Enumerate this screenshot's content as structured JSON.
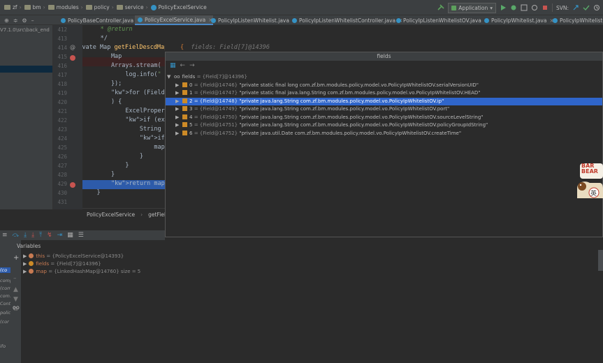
{
  "navbar": {
    "crumbs": [
      "zf",
      "bm",
      "modules",
      "policy",
      "service",
      "PolicyExcelService"
    ],
    "run_config": "Application",
    "svn_label": "SVN:"
  },
  "tabs": [
    {
      "label": "PolicyBaseController.java"
    },
    {
      "label": "PolicyExcelService.java"
    },
    {
      "label": "PolicyIpListenWhitelist.java"
    },
    {
      "label": "PolicyIpListenWhitelistController.java"
    },
    {
      "label": "PolicyIpListenWhitelistOV.java"
    },
    {
      "label": "PolicyIpWhitelist.java"
    },
    {
      "label": "PolicyIpWhitelistOV.j..."
    }
  ],
  "project": {
    "path": "V7.1.0\\src\\back_end"
  },
  "editor": {
    "line_numbers": [
      "412",
      "413",
      "414",
      "415",
      "416",
      "417",
      "418",
      "419",
      "420",
      "421",
      "422",
      "423",
      "424",
      "425",
      "426",
      "427",
      "428",
      "429",
      "430",
      "431"
    ],
    "lines": [
      "     * @return",
      "     */",
      "    private Map<String, String> getFielDescdMap(Field[] fields) {",
      "        Map<String, St",
      "        Arrays.stream(",
      "            log.info(\"",
      "        });",
      "        for (Field fie",
      "        ) {",
      "            ExcelProper",
      "            if (excelPr",
      "                String",
      "                if (de",
      "                    map",
      "                }",
      "            }",
      "        }",
      "        return map;  m",
      "    }",
      ""
    ],
    "inline_hint": "fields: Field[7]@14396",
    "footer": [
      "PolicyExcelService",
      "getFielDescd"
    ]
  },
  "popup": {
    "title": "fields",
    "root": {
      "name": "fields",
      "value": "{Field[7]@14396}"
    },
    "items": [
      {
        "index": "0",
        "ref": "{Field@14746}",
        "text": "\"private static final long com.zf.bm.modules.policy.model.vo.PolicyIpWhitelistOV.serialVersionUID\""
      },
      {
        "index": "1",
        "ref": "{Field@14747}",
        "text": "\"private static final java.lang.String com.zf.bm.modules.policy.model.vo.PolicyIpWhitelistOV.HEAD\""
      },
      {
        "index": "2",
        "ref": "{Field@14748}",
        "text": "\"private java.lang.String com.zf.bm.modules.policy.model.vo.PolicyIpWhitelistOV.ip\""
      },
      {
        "index": "3",
        "ref": "{Field@14749}",
        "text": "\"private java.lang.String com.zf.bm.modules.policy.model.vo.PolicyIpWhitelistOV.port\""
      },
      {
        "index": "4",
        "ref": "{Field@14750}",
        "text": "\"private java.lang.String com.zf.bm.modules.policy.model.vo.PolicyIpWhitelistOV.sourceLevelString\""
      },
      {
        "index": "5",
        "ref": "{Field@14751}",
        "text": "\"private java.lang.String com.zf.bm.modules.policy.model.vo.PolicyIpWhitelistOV.policyGroupIdString\""
      },
      {
        "index": "6",
        "ref": "{Field@14752}",
        "text": "\"private java.util.Date com.zf.bm.modules.policy.model.vo.PolicyIpWhitelistOV.createTime\""
      }
    ],
    "selected_index": 2
  },
  "mascot": {
    "text": "BAR\nBEAR",
    "badge": "英"
  },
  "debug": {
    "variables_title": "Variables",
    "vars": [
      {
        "name": "this",
        "value": "= {PolicyExcelService@14393}",
        "color": "#c77a52"
      },
      {
        "name": "fields",
        "value": "= {Field[7]@14396}",
        "color": "#cc8a27"
      },
      {
        "name": "map",
        "value": "= {LinkedHashMap@14760}  size = 5",
        "color": "#c77a52"
      }
    ],
    "frames": [
      "(co",
      "comp",
      "(com",
      "com.zf.b",
      "Contr",
      "polic",
      "(cor",
      "ifo"
    ]
  }
}
